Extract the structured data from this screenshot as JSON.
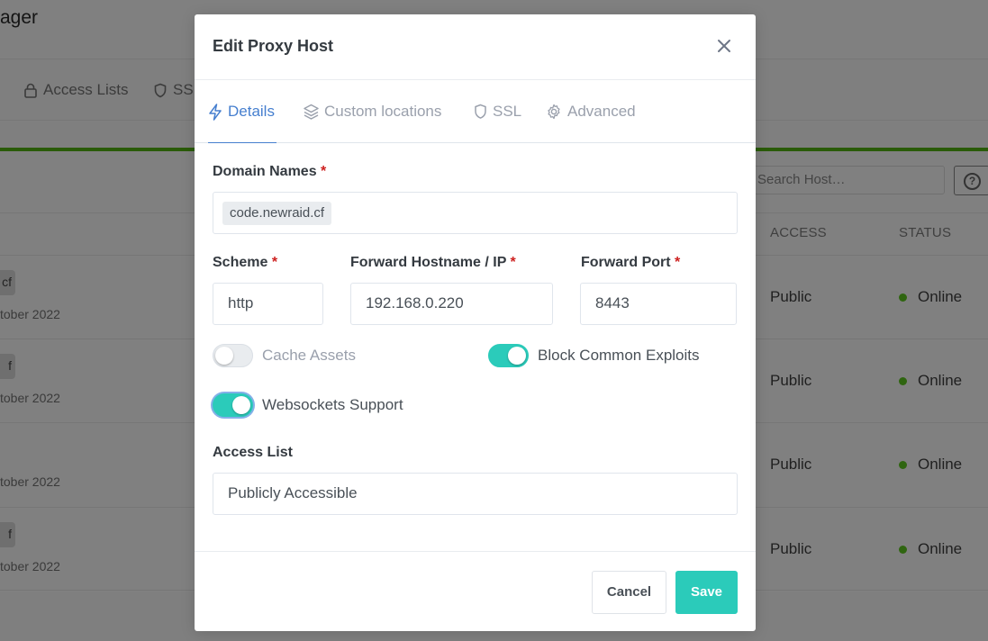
{
  "background": {
    "brand_fragment": "ager",
    "nav": [
      {
        "label": "Access Lists",
        "icon": "lock-icon"
      },
      {
        "label": "SSL",
        "icon": "shield-icon"
      }
    ],
    "search_placeholder": "Search Host…",
    "columns": {
      "access": "ACCESS",
      "status": "STATUS"
    },
    "rows": [
      {
        "domain_fragment": "cf",
        "date_fragment": "tober 2022",
        "access": "Public",
        "status": "Online"
      },
      {
        "domain_fragment": "f",
        "date_fragment": "tober 2022",
        "access": "Public",
        "status": "Online"
      },
      {
        "domain_fragment": "",
        "date_fragment": "tober 2022",
        "access": "Public",
        "status": "Online"
      },
      {
        "domain_fragment": "f",
        "date_fragment": "tober 2022",
        "access": "Public",
        "status": "Online"
      }
    ]
  },
  "modal": {
    "title": "Edit Proxy Host",
    "tabs": [
      {
        "label": "Details",
        "icon": "bolt-icon",
        "active": true
      },
      {
        "label": "Custom locations",
        "icon": "layers-icon",
        "active": false
      },
      {
        "label": "SSL",
        "icon": "shield-icon",
        "active": false
      },
      {
        "label": "Advanced",
        "icon": "gear-icon",
        "active": false
      }
    ],
    "domain_names": {
      "label": "Domain Names",
      "required_mark": "*",
      "tags": [
        "code.newraid.cf"
      ]
    },
    "scheme": {
      "label": "Scheme",
      "required_mark": "*",
      "value": "http"
    },
    "forward_host": {
      "label": "Forward Hostname / IP",
      "required_mark": "*",
      "value": "192.168.0.220"
    },
    "forward_port": {
      "label": "Forward Port",
      "required_mark": "*",
      "value": "8443"
    },
    "toggles": {
      "cache_assets": {
        "label": "Cache Assets",
        "on": false
      },
      "block_exploits": {
        "label": "Block Common Exploits",
        "on": true
      },
      "websockets": {
        "label": "Websockets Support",
        "on": true
      }
    },
    "access_list": {
      "label": "Access List",
      "value": "Publicly Accessible"
    },
    "buttons": {
      "cancel": "Cancel",
      "save": "Save"
    }
  },
  "colors": {
    "accent": "#467fcf",
    "toggle_on": "#2bcbba",
    "required": "#cd201f",
    "online": "#5eba00"
  }
}
